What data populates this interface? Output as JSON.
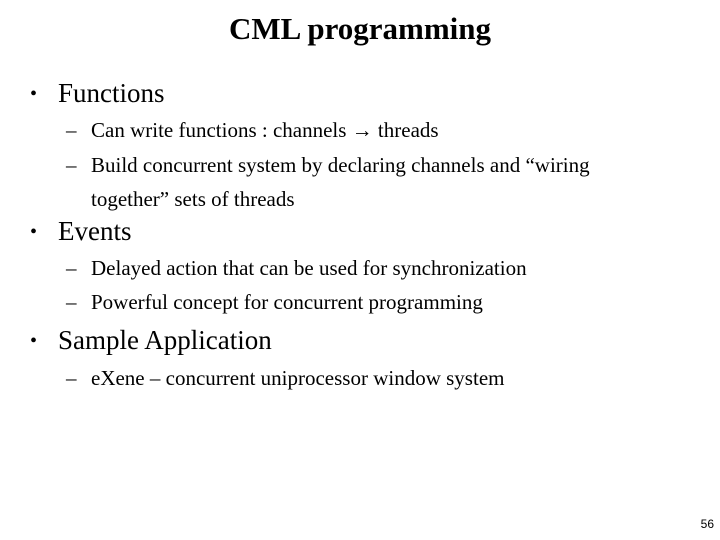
{
  "slide": {
    "title": "CML programming",
    "bullet_glyph": "•",
    "dash_glyph": "–",
    "sections": [
      {
        "label": "Functions",
        "items": [
          {
            "text": "Can write functions : channels → threads"
          },
          {
            "text": "Build concurrent system by declaring channels and “wiring",
            "continuation": "together” sets of threads"
          }
        ]
      },
      {
        "label": "Events",
        "items": [
          {
            "text": "Delayed action that can be used for synchronization"
          },
          {
            "text": "Powerful concept for concurrent programming"
          }
        ]
      },
      {
        "label": "Sample Application",
        "items": [
          {
            "text": "eXene – concurrent uniprocessor window system"
          }
        ]
      }
    ],
    "page_number": "56"
  }
}
